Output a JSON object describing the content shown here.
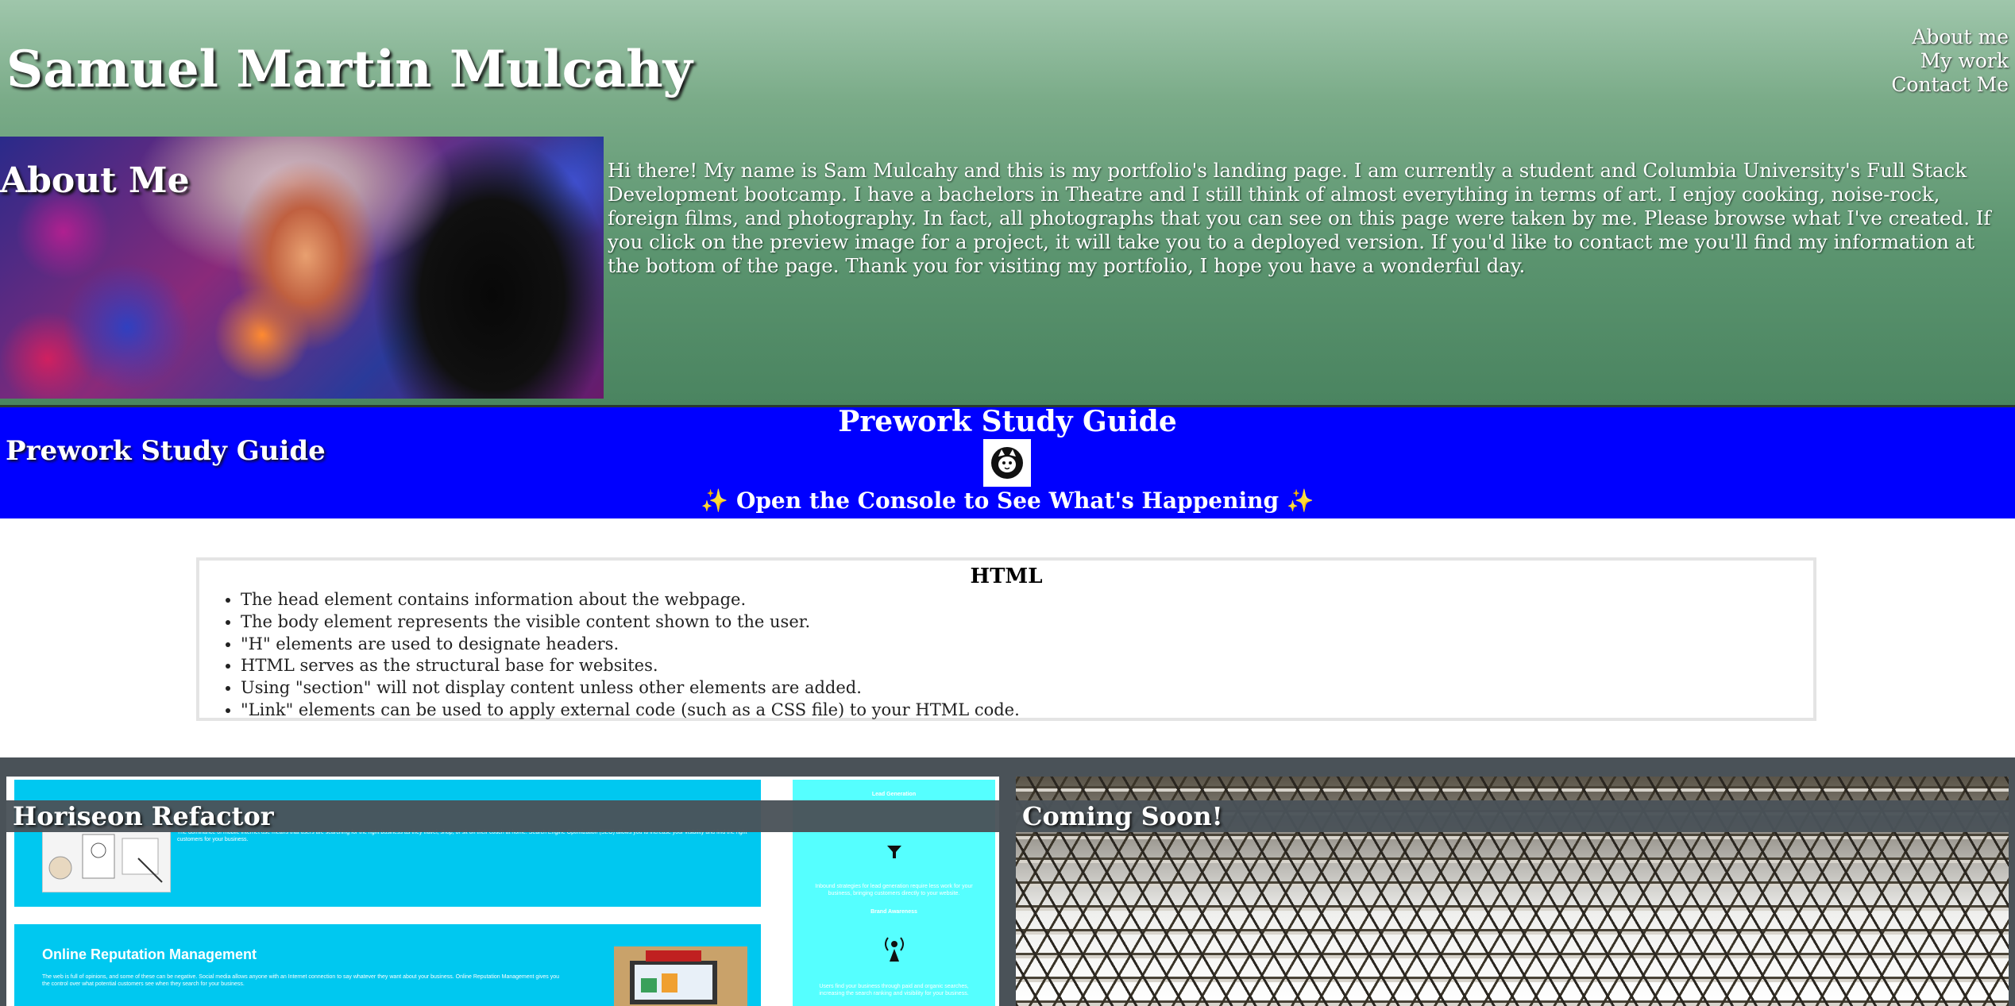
{
  "header": {
    "title": "Samuel Martin Mulcahy",
    "nav": [
      "About me",
      "My work",
      "Contact Me"
    ]
  },
  "about": {
    "heading": "About Me",
    "text": "Hi there! My name is Sam Mulcahy and this is my portfolio's landing page. I am currently a student and Columbia University's Full Stack Development bootcamp. I have a bachelors in Theatre and I still think of almost everything in terms of art. I enjoy cooking, noise-rock, foreign films, and photography. In fact, all photographs that you can see on this page were taken by me. Please browse what I've created. If you click on the preview image for a project, it will take you to a deployed version. If you'd like to contact me you'll find my information at the bottom of the page. Thank you for visiting my portfolio, I hope you have a wonderful day."
  },
  "prework": {
    "label": "Prework Study Guide",
    "title": "Prework Study Guide",
    "console_note": "Open the Console to See What's Happening",
    "sparkle": "✨",
    "logo_icon": "cat-logo-icon"
  },
  "html_card": {
    "heading": "HTML",
    "items": [
      "The head element contains information about the webpage.",
      "The body element represents the visible content shown to the user.",
      "\"H\" elements are used to designate headers.",
      "HTML serves as the structural base for websites.",
      "Using \"section\" will not display content unless other elements are added.",
      "\"Link\" elements can be used to apply external code (such as a CSS file) to your HTML code."
    ]
  },
  "projects": {
    "horiseon": {
      "label": "Horiseon Refactor",
      "preview_body_1": "The dominance of mobile internet use means that users are searching for the right business as they travel, shop, or sit on their couch at home. Search Engine Optimization (SEO) allows you to increase your visibility and find the right customers for your business.",
      "preview_heading_2": "Online Reputation Management",
      "preview_body_2": "The web is full of opinions, and some of these can be negative. Social media allows anyone with an Internet connection to say whatever they want about your business. Online Reputation Management gives you the control over what potential customers see when they search for your business.",
      "side_heading_1": "Lead Generation",
      "side_body_1": "Inbound strategies for lead generation require less work for your business, bringing customers directly to your website.",
      "side_heading_2": "Brand Awareness",
      "side_body_2": "Users find your business through paid and organic searches, increasing the search ranking and visibility for your business."
    },
    "coming_soon": {
      "label": "Coming Soon!"
    }
  },
  "colors": {
    "header_top": "#9fc6ab",
    "header_bottom": "#4a8460",
    "prework_bg": "#0000ff",
    "projects_bg": "#4a5258",
    "horiseon_blue": "#00c8f0",
    "horiseon_side": "#55ffff"
  }
}
